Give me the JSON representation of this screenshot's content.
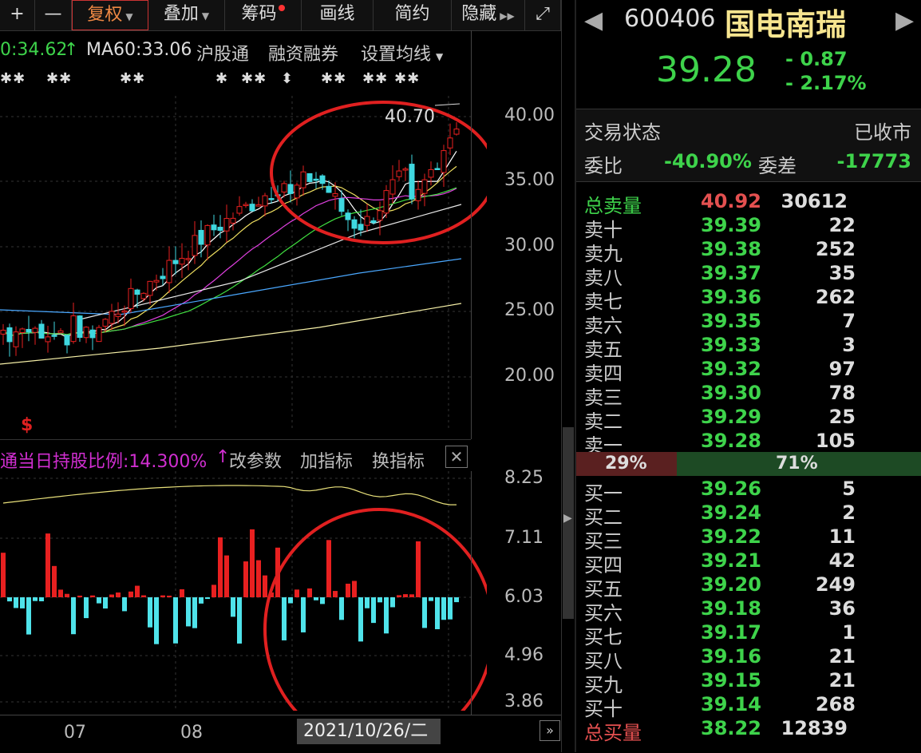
{
  "toolbar": {
    "items": [
      {
        "label": "+"
      },
      {
        "label": "—"
      },
      {
        "label": "复权"
      },
      {
        "label": "叠加"
      },
      {
        "label": "筹码"
      },
      {
        "label": "画线"
      },
      {
        "label": "简约"
      },
      {
        "label": "隐藏"
      },
      {
        "label": "⤢"
      }
    ]
  },
  "ma_bar": {
    "ma_partial": "0:34.62",
    "ma_arrow": "↑",
    "ma60": "MA60:33.06",
    "hgt": "沪股通",
    "rzrq": "融资融券",
    "settings": "设置均线"
  },
  "main_axis": [
    "40.00",
    "35.00",
    "30.00",
    "25.00",
    "20.00"
  ],
  "high_label": "40.70",
  "sub_bar": {
    "indicator": "通当日持股比例:14.300%",
    "arrow": "↑",
    "change": "改参数",
    "add": "加指标",
    "swap": "换指标"
  },
  "sub_axis": [
    "8.25",
    "7.11",
    "6.03",
    "4.96",
    "3.86"
  ],
  "x_axis": [
    "07",
    "08"
  ],
  "cursor_date": "2021/10/26/二",
  "stock": {
    "code": "600406",
    "name": "国电南瑞",
    "price": "39.28",
    "change": "- 0.87",
    "change_pct": "- 2.17%"
  },
  "status": {
    "label": "交易状态",
    "value": "已收市"
  },
  "weibi": {
    "label": "委比",
    "value": "-40.90%",
    "diff_label": "委差",
    "diff_value": "-17773"
  },
  "sell_total": {
    "label": "总卖量",
    "price": "40.92",
    "volume": "30612"
  },
  "asks": [
    {
      "label": "卖十",
      "price": "39.39",
      "volume": "22"
    },
    {
      "label": "卖九",
      "price": "39.38",
      "volume": "252"
    },
    {
      "label": "卖八",
      "price": "39.37",
      "volume": "35"
    },
    {
      "label": "卖七",
      "price": "39.36",
      "volume": "262"
    },
    {
      "label": "卖六",
      "price": "39.35",
      "volume": "7"
    },
    {
      "label": "卖五",
      "price": "39.33",
      "volume": "3"
    },
    {
      "label": "卖四",
      "price": "39.32",
      "volume": "97"
    },
    {
      "label": "卖三",
      "price": "39.30",
      "volume": "78"
    },
    {
      "label": "卖二",
      "price": "39.29",
      "volume": "25"
    },
    {
      "label": "卖一",
      "price": "39.28",
      "volume": "105"
    }
  ],
  "ratio": {
    "buy": "29%",
    "sell": "71%",
    "buy_fraction": 0.29
  },
  "bids": [
    {
      "label": "买一",
      "price": "39.26",
      "volume": "5"
    },
    {
      "label": "买二",
      "price": "39.24",
      "volume": "2"
    },
    {
      "label": "买三",
      "price": "39.22",
      "volume": "11"
    },
    {
      "label": "买四",
      "price": "39.21",
      "volume": "42"
    },
    {
      "label": "买五",
      "price": "39.20",
      "volume": "249"
    },
    {
      "label": "买六",
      "price": "39.18",
      "volume": "36"
    },
    {
      "label": "买七",
      "price": "39.17",
      "volume": "1"
    },
    {
      "label": "买八",
      "price": "39.16",
      "volume": "21"
    },
    {
      "label": "买九",
      "price": "39.15",
      "volume": "21"
    },
    {
      "label": "买十",
      "price": "39.14",
      "volume": "268"
    }
  ],
  "buy_total": {
    "label": "总买量",
    "price": "38.22",
    "volume": "12839"
  },
  "colors": {
    "up": "#e82020",
    "down": "#3ed34b",
    "highlight": "#e02020",
    "name": "#f7e58f"
  }
}
